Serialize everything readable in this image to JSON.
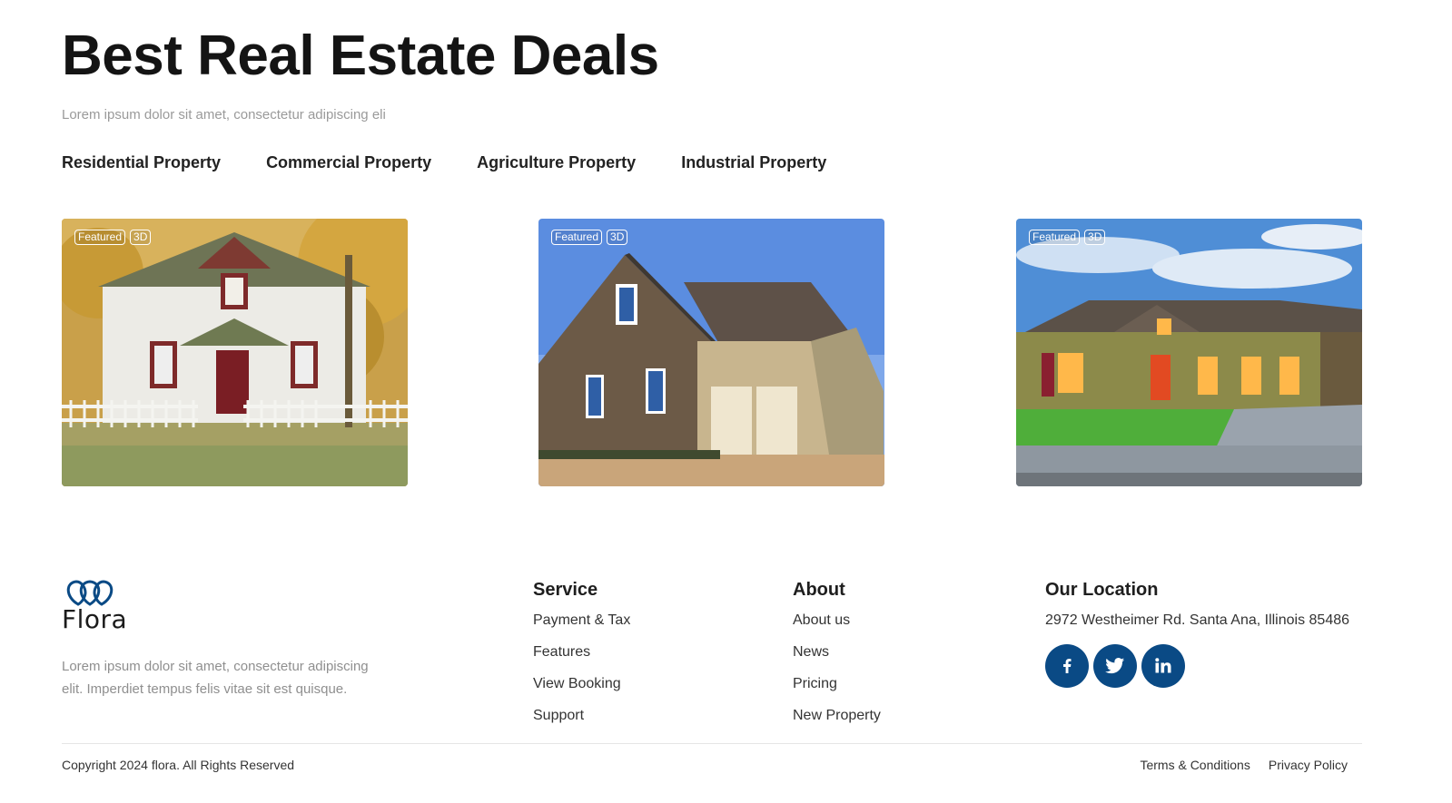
{
  "header": {
    "title": "Best Real Estate Deals",
    "subtitle": "Lorem ipsum dolor sit amet, consectetur adipiscing eli"
  },
  "tabs": [
    {
      "label": "Residential Property"
    },
    {
      "label": "Commercial Property"
    },
    {
      "label": "Agriculture Property"
    },
    {
      "label": "Industrial Property"
    }
  ],
  "cards": [
    {
      "badges": [
        "Featured",
        "3D"
      ],
      "image": "white-cottage-autumn"
    },
    {
      "badges": [
        "Featured",
        "3D"
      ],
      "image": "brown-two-storey-house"
    },
    {
      "badges": [
        "Featured",
        "3D"
      ],
      "image": "ranch-house-green-lawn"
    }
  ],
  "footer": {
    "logo_text": "Flora",
    "description": "Lorem ipsum dolor sit amet, consectetur adipiscing elit. Imperdiet tempus felis vitae sit est quisque.",
    "service": {
      "title": "Service",
      "links": [
        "Payment & Tax",
        "Features",
        "View Booking",
        "Support"
      ]
    },
    "about": {
      "title": "About",
      "links": [
        "About us",
        "News",
        "Pricing",
        "New Property"
      ]
    },
    "location": {
      "title": "Our Location",
      "address": "2972 Westheimer Rd. Santa Ana, Illinois 85486",
      "socials": [
        "facebook-icon",
        "twitter-icon",
        "linkedin-icon"
      ]
    },
    "copyright": "Copyright 2024 flora. All Rights Reserved",
    "legal": [
      "Terms & Conditions",
      "Privacy Policy"
    ]
  },
  "colors": {
    "brand": "#0a4a85",
    "text": "#1a1a1a",
    "muted": "#9a9a9a"
  }
}
